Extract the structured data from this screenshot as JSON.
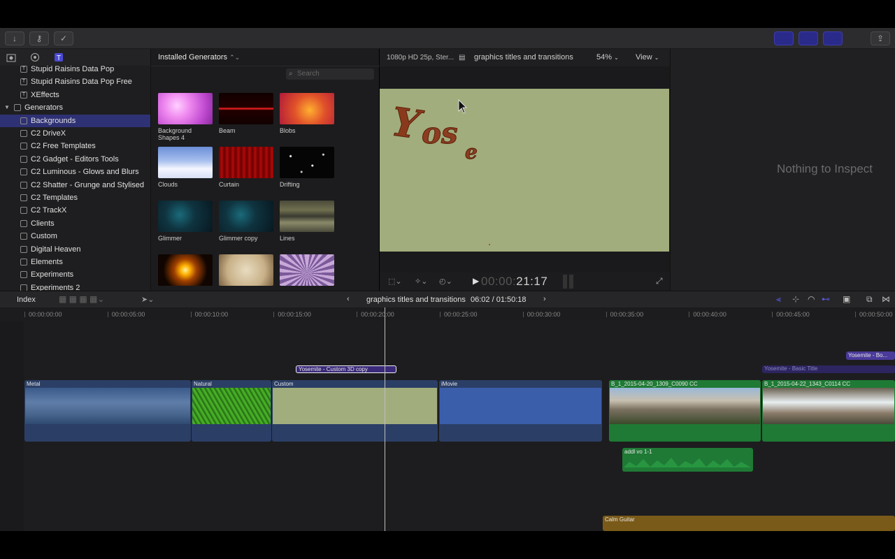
{
  "library": {
    "items": [
      {
        "label": "Stupid Raisins Data Pop",
        "kind": "template",
        "indent": 2,
        "selected": false
      },
      {
        "label": "Stupid Raisins Data Pop Free",
        "kind": "template",
        "indent": 2,
        "selected": false
      },
      {
        "label": "XEffects",
        "kind": "template",
        "indent": 2,
        "selected": false
      },
      {
        "label": "Generators",
        "kind": "folder",
        "indent": 1,
        "selected": false
      },
      {
        "label": "Backgrounds",
        "kind": "folder",
        "indent": 2,
        "selected": true
      },
      {
        "label": "C2 DriveX",
        "kind": "folder",
        "indent": 2,
        "selected": false
      },
      {
        "label": "C2 Free Templates",
        "kind": "folder",
        "indent": 2,
        "selected": false
      },
      {
        "label": "C2 Gadget - Editors Tools",
        "kind": "folder",
        "indent": 2,
        "selected": false
      },
      {
        "label": "C2 Luminous - Glows and Blurs",
        "kind": "folder",
        "indent": 2,
        "selected": false
      },
      {
        "label": "C2 Shatter - Grunge and Stylised",
        "kind": "folder",
        "indent": 2,
        "selected": false
      },
      {
        "label": "C2 Templates",
        "kind": "folder",
        "indent": 2,
        "selected": false
      },
      {
        "label": "C2 TrackX",
        "kind": "folder",
        "indent": 2,
        "selected": false
      },
      {
        "label": "Clients",
        "kind": "folder",
        "indent": 2,
        "selected": false
      },
      {
        "label": "Custom",
        "kind": "folder",
        "indent": 2,
        "selected": false
      },
      {
        "label": "Digital Heaven",
        "kind": "folder",
        "indent": 2,
        "selected": false
      },
      {
        "label": "Elements",
        "kind": "folder",
        "indent": 2,
        "selected": false
      },
      {
        "label": "Experiments",
        "kind": "folder",
        "indent": 2,
        "selected": false
      },
      {
        "label": "Experiments 2",
        "kind": "folder",
        "indent": 2,
        "selected": false
      }
    ]
  },
  "browser": {
    "title": "Installed Generators",
    "search_placeholder": "Search",
    "generators": [
      {
        "label": "Background Shapes 4",
        "thumb": "pink-shapes"
      },
      {
        "label": "Beam",
        "thumb": "red-beam"
      },
      {
        "label": "Blobs",
        "thumb": "orange-blobs"
      },
      {
        "label": "Clouds",
        "thumb": "clouds"
      },
      {
        "label": "Curtain",
        "thumb": "red-curtain"
      },
      {
        "label": "Drifting",
        "thumb": "starfield"
      },
      {
        "label": "Glimmer",
        "thumb": "teal-glimmer"
      },
      {
        "label": "Glimmer copy",
        "thumb": "teal-glimmer"
      },
      {
        "label": "Lines",
        "thumb": "lines"
      },
      {
        "label": "",
        "thumb": "orange-sun"
      },
      {
        "label": "",
        "thumb": "parchment"
      },
      {
        "label": "",
        "thumb": "radial-rays"
      }
    ]
  },
  "viewer": {
    "format": "1080p HD 25p, Ster...",
    "project": "graphics titles and transitions",
    "zoom": "54%",
    "view_label": "View",
    "canvas_text": "Yose",
    "timecode_dim": "00:00:",
    "timecode_main": "21:17"
  },
  "inspector": {
    "message": "Nothing to Inspect"
  },
  "timeline": {
    "index_label": "Index",
    "project": "graphics titles and transitions",
    "duration": "06:02 / 01:50:18",
    "ruler": [
      "00:00:00:00",
      "00:00:05:00",
      "00:00:10:00",
      "00:00:15:00",
      "00:00:20:00",
      "00:00:25:00",
      "00:00:30:00",
      "00:00:35:00",
      "00:00:40:00",
      "00:00:45:00",
      "00:00:50:00"
    ],
    "title_clip": "Yosemite - Custom 3D copy",
    "title_clip_2": "Yosemite - Basic Title",
    "title_clip_3": "Yosemite - Bo...",
    "clips": [
      {
        "label": "Metal",
        "thumb": "metal"
      },
      {
        "label": "Natural",
        "thumb": "grass"
      },
      {
        "label": "Custom",
        "thumb": "sage"
      },
      {
        "label": "iMovie",
        "thumb": "blue"
      },
      {
        "label": "B_1_2015-04-20_1309_C0090 CC",
        "thumb": "mountains"
      },
      {
        "label": "B_1_2015-04-22_1343_C0114 CC",
        "thumb": "waterfall"
      }
    ],
    "audio_clip": "addl vo 1-1",
    "music_clip": "Calm Guitar"
  },
  "colors": {
    "accent": "#3b3fbf",
    "selection": "#2f3175",
    "video_clip": "#2b4a7a",
    "audio_clip": "#1f7a35",
    "music_clip": "#7a5a18",
    "canvas": "#a1ad7c"
  }
}
